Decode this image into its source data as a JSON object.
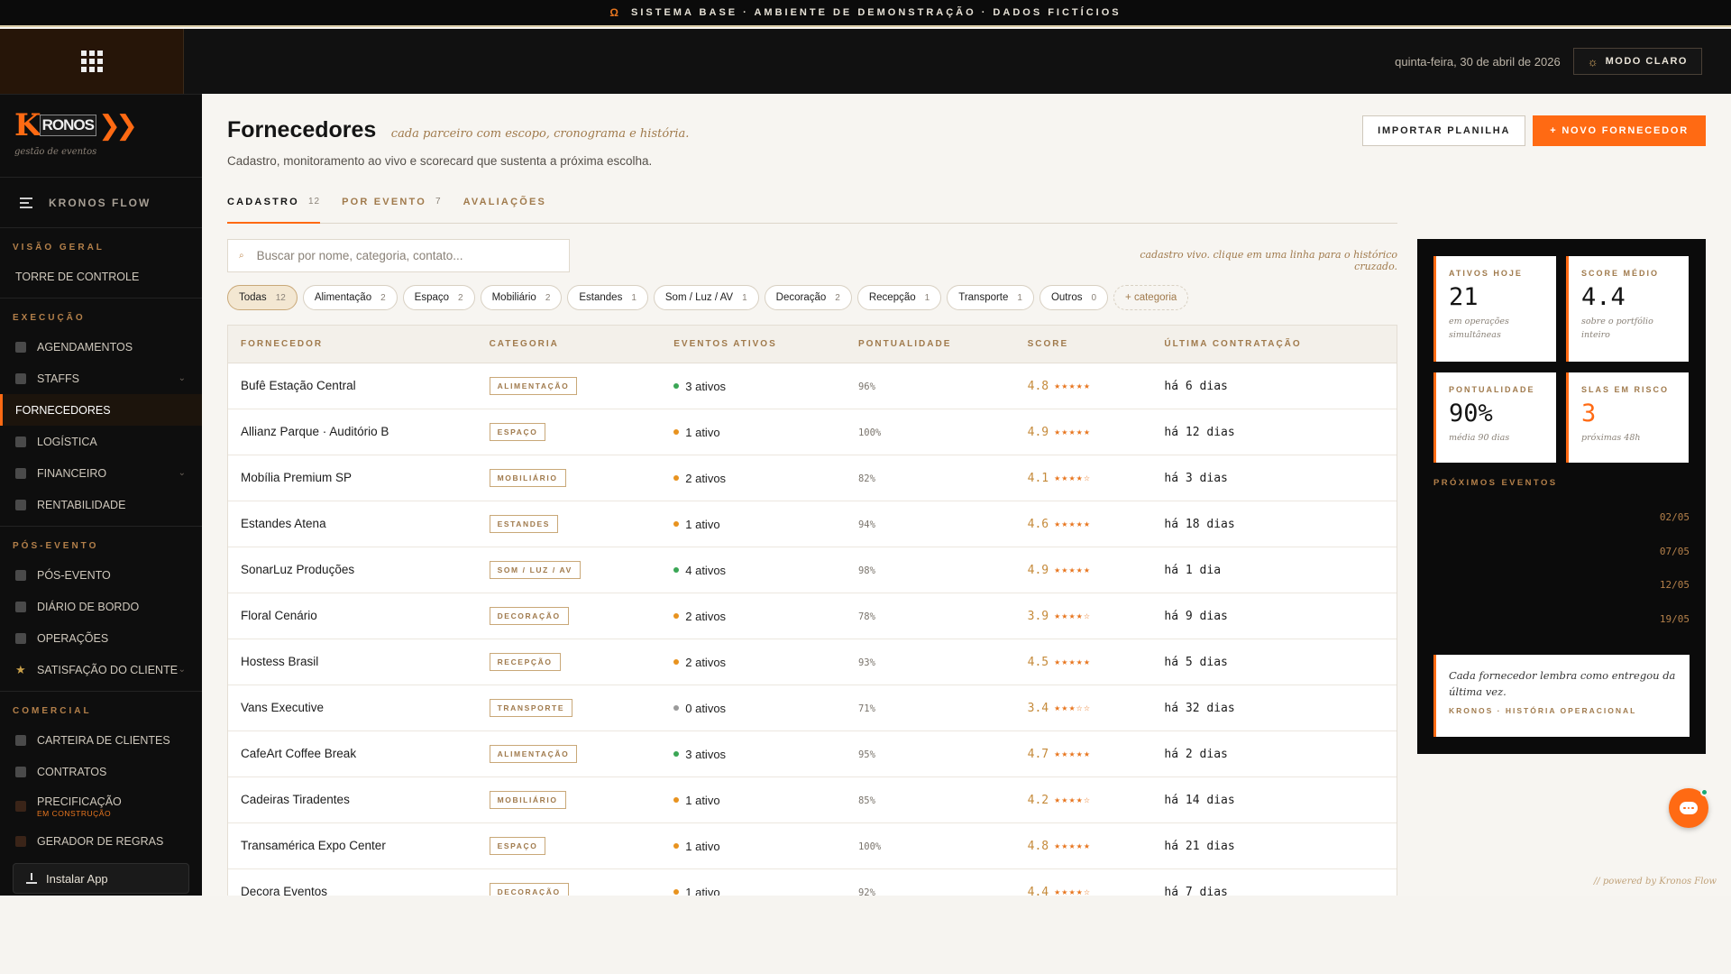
{
  "announcement": {
    "icon": "omega-icon",
    "text": "SISTEMA BASE · AMBIENTE DE DEMONSTRAÇÃO · DADOS FICTÍCIOS"
  },
  "header": {
    "date": "quinta-feira, 30 de abril de 2026",
    "mode_button": "MODO CLARO"
  },
  "sidebar": {
    "logo_tagline": "gestão de eventos",
    "flow_label": "KRONOS FLOW",
    "sections": {
      "visao_geral": "VISÃO GERAL",
      "execucao": "EXECUÇÃO",
      "pos_evento": "PÓS-EVENTO",
      "comercial": "COMERCIAL"
    },
    "items": {
      "torre": "TORRE DE CONTROLE",
      "agendamentos": "AGENDAMENTOS",
      "staffs": "STAFFS",
      "fornecedores": "FORNECEDORES",
      "logistica": "LOGÍSTICA",
      "financeiro": "FINANCEIRO",
      "rentabilidade": "RENTABILIDADE",
      "pos_evento": "PÓS-EVENTO",
      "diario": "DIÁRIO DE BORDO",
      "operacoes": "OPERAÇÕES",
      "satisfacao": "SATISFAÇÃO DO CLIENTE",
      "carteira": "CARTEIRA DE CLIENTES",
      "contratos": "CONTRATOS",
      "precificacao": "PRECIFICAÇÃO",
      "precificacao_note": "EM CONSTRUÇÃO",
      "gerador": "GERADOR DE REGRAS"
    },
    "install_label": "Instalar App"
  },
  "page": {
    "title": "Fornecedores",
    "tagline": "cada parceiro com escopo, cronograma e história.",
    "subtitle": "Cadastro, monitoramento ao vivo e scorecard que sustenta a próxima escolha.",
    "import_button": "IMPORTAR PLANILHA",
    "new_button": "+ NOVO FORNECEDOR"
  },
  "tabs": [
    {
      "label": "CADASTRO",
      "count": "12"
    },
    {
      "label": "POR EVENTO",
      "count": "7"
    },
    {
      "label": "AVALIAÇÕES",
      "count": ""
    }
  ],
  "search": {
    "placeholder": "Buscar por nome, categoria, contato..."
  },
  "live_note": "cadastro vivo. clique em uma linha para o histórico cruzado.",
  "chips": [
    {
      "label": "Todas",
      "count": "12"
    },
    {
      "label": "Alimentação",
      "count": "2"
    },
    {
      "label": "Espaço",
      "count": "2"
    },
    {
      "label": "Mobiliário",
      "count": "2"
    },
    {
      "label": "Estandes",
      "count": "1"
    },
    {
      "label": "Som / Luz / AV",
      "count": "1"
    },
    {
      "label": "Decoração",
      "count": "2"
    },
    {
      "label": "Recepção",
      "count": "1"
    },
    {
      "label": "Transporte",
      "count": "1"
    },
    {
      "label": "Outros",
      "count": "0"
    }
  ],
  "add_category": "+ categoria",
  "table": {
    "headers": {
      "fornecedor": "FORNECEDOR",
      "categoria": "CATEGORIA",
      "eventos": "EVENTOS ATIVOS",
      "pontualidade": "PONTUALIDADE",
      "score": "SCORE",
      "ultima": "ÚLTIMA CONTRATAÇÃO"
    },
    "rows": [
      {
        "name": "Bufê Estação Central",
        "category": "ALIMENTAÇÃO",
        "events": "3 ativos",
        "status_color": "#3aa655",
        "punctuality": "96%",
        "score": "4.8",
        "stars": "★★★★★",
        "last": "há 6 dias"
      },
      {
        "name": "Allianz Parque · Auditório B",
        "category": "ESPAÇO",
        "events": "1 ativo",
        "status_color": "#e8931f",
        "punctuality": "100%",
        "score": "4.9",
        "stars": "★★★★★",
        "last": "há 12 dias"
      },
      {
        "name": "Mobília Premium SP",
        "category": "MOBILIÁRIO",
        "events": "2 ativos",
        "status_color": "#e8931f",
        "punctuality": "82%",
        "score": "4.1",
        "stars": "★★★★☆",
        "last": "há 3 dias"
      },
      {
        "name": "Estandes Atena",
        "category": "ESTANDES",
        "events": "1 ativo",
        "status_color": "#e8931f",
        "punctuality": "94%",
        "score": "4.6",
        "stars": "★★★★★",
        "last": "há 18 dias"
      },
      {
        "name": "SonarLuz Produções",
        "category": "SOM / LUZ / AV",
        "events": "4 ativos",
        "status_color": "#3aa655",
        "punctuality": "98%",
        "score": "4.9",
        "stars": "★★★★★",
        "last": "há 1 dia"
      },
      {
        "name": "Floral Cenário",
        "category": "DECORAÇÃO",
        "events": "2 ativos",
        "status_color": "#e8931f",
        "punctuality": "78%",
        "score": "3.9",
        "stars": "★★★★☆",
        "last": "há 9 dias"
      },
      {
        "name": "Hostess Brasil",
        "category": "RECEPÇÃO",
        "events": "2 ativos",
        "status_color": "#e8931f",
        "punctuality": "93%",
        "score": "4.5",
        "stars": "★★★★★",
        "last": "há 5 dias"
      },
      {
        "name": "Vans Executive",
        "category": "TRANSPORTE",
        "events": "0 ativos",
        "status_color": "#9a9a9a",
        "punctuality": "71%",
        "score": "3.4",
        "stars": "★★★☆☆",
        "last": "há 32 dias"
      },
      {
        "name": "CafeArt Coffee Break",
        "category": "ALIMENTAÇÃO",
        "events": "3 ativos",
        "status_color": "#3aa655",
        "punctuality": "95%",
        "score": "4.7",
        "stars": "★★★★★",
        "last": "há 2 dias"
      },
      {
        "name": "Cadeiras Tiradentes",
        "category": "MOBILIÁRIO",
        "events": "1 ativo",
        "status_color": "#e8931f",
        "punctuality": "85%",
        "score": "4.2",
        "stars": "★★★★☆",
        "last": "há 14 dias"
      },
      {
        "name": "Transamérica Expo Center",
        "category": "ESPAÇO",
        "events": "1 ativo",
        "status_color": "#e8931f",
        "punctuality": "100%",
        "score": "4.8",
        "stars": "★★★★★",
        "last": "há 21 dias"
      },
      {
        "name": "Decora Eventos",
        "category": "DECORAÇÃO",
        "events": "1 ativo",
        "status_color": "#e8931f",
        "punctuality": "92%",
        "score": "4.4",
        "stars": "★★★★☆",
        "last": "há 7 dias"
      }
    ]
  },
  "panel": {
    "kpis": {
      "ativos": {
        "label": "ATIVOS HOJE",
        "value": "21",
        "hint": "em operações simultâneas"
      },
      "score": {
        "label": "SCORE MÉDIO",
        "value": "4.4",
        "hint": "sobre o portfólio inteiro"
      },
      "pontualidade": {
        "label": "PONTUALIDADE",
        "value": "90%",
        "hint": "média 90 dias"
      },
      "slas": {
        "label": "SLAS EM RISCO",
        "value": "3",
        "hint": "próximas 48h"
      }
    },
    "upcoming_label": "PRÓXIMOS EVENTOS",
    "upcoming_dates": [
      "02/05",
      "07/05",
      "12/05",
      "19/05"
    ],
    "quote": "Cada fornecedor lembra como entregou da última vez.",
    "quote_source": "KRONOS · HISTÓRIA OPERACIONAL"
  },
  "powered_by": "// powered by Kronos Flow",
  "colors": {
    "accent": "#ff6a13",
    "gold": "#a07a4c",
    "dark": "#0b0b0b"
  }
}
